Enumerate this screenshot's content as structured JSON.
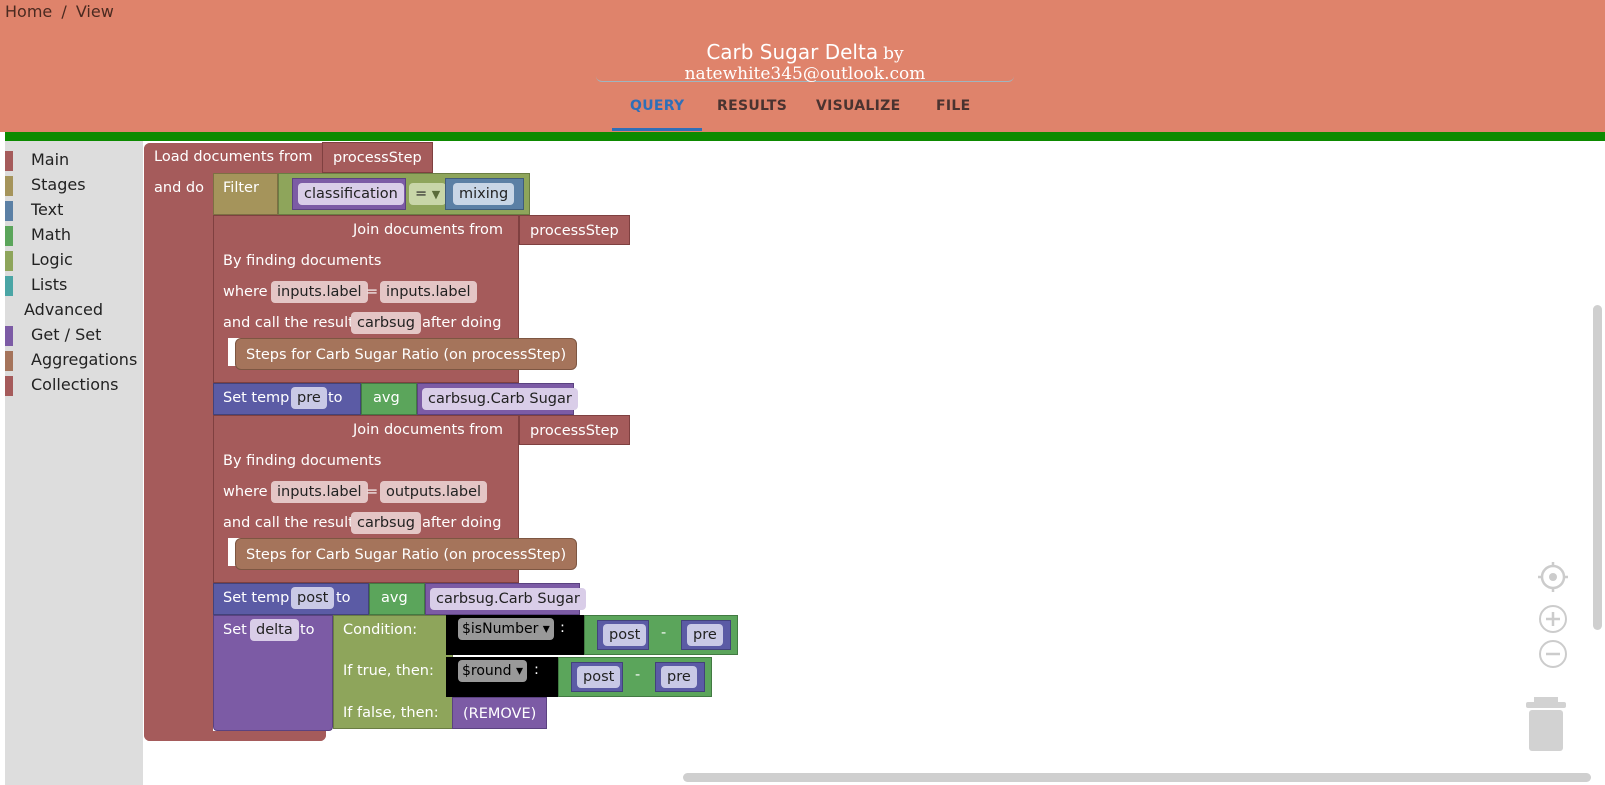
{
  "breadcrumb": [
    "Home",
    "View"
  ],
  "header": {
    "title": "Carb Sugar Delta",
    "author": "by natewhite345@outlook.com",
    "tabs": [
      {
        "label": "QUERY",
        "active": true
      },
      {
        "label": "RESULTS",
        "active": false
      },
      {
        "label": "VISUALIZE",
        "active": false
      },
      {
        "label": "FILE",
        "active": false
      }
    ]
  },
  "colors": {
    "header": "#DF836B",
    "accent_bar": "#0c8a00",
    "active_tab": "#2f6fb8",
    "collections_block": "#A55B5B",
    "stage_block": "#A5745B",
    "logic_block": "#8EA55B",
    "math_block": "#5BA55B",
    "text_block": "#5B80A5",
    "getset_block": "#7C5BA5",
    "variable_block": "#5B5BA5"
  },
  "toolbox": {
    "items": [
      {
        "label": "Main",
        "color": "#A55B5B"
      },
      {
        "label": "Stages",
        "color": "#A5945B"
      },
      {
        "label": "Text",
        "color": "#5B80A5"
      },
      {
        "label": "Math",
        "color": "#5BA55B"
      },
      {
        "label": "Logic",
        "color": "#8EA55B"
      },
      {
        "label": "Lists",
        "color": "#4AA5A5"
      }
    ],
    "advanced_heading": "Advanced",
    "advanced_items": [
      {
        "label": "Get / Set",
        "color": "#7C5BA5"
      },
      {
        "label": "Aggregations",
        "color": "#A5745B"
      },
      {
        "label": "Collections",
        "color": "#A55B5B"
      }
    ]
  },
  "workspace": {
    "load": {
      "label": "Load documents from",
      "collection": "processStep",
      "and_do": "and do"
    },
    "filter": {
      "label": "Filter",
      "field": "classification",
      "op": "=",
      "value": "mixing"
    },
    "join1": {
      "label": "Join documents from",
      "collection": "processStep",
      "by_finding": "By finding documents",
      "where": "where",
      "left": "inputs.label",
      "eq": "=",
      "right": "inputs.label",
      "call_result": "and call the result",
      "var": "carbsug",
      "after_doing": "after doing",
      "steps": "Steps for Carb Sugar Ratio (on processStep)"
    },
    "set_pre": {
      "set_temp": "Set temp",
      "var": "pre",
      "to": "to",
      "fn": "avg",
      "arg": "carbsug.Carb Sugar"
    },
    "join2": {
      "label": "Join documents from",
      "collection": "processStep",
      "by_finding": "By finding documents",
      "where": "where",
      "left": "inputs.label",
      "eq": "=",
      "right": "outputs.label",
      "call_result": "and call the result",
      "var": "carbsug",
      "after_doing": "after doing",
      "steps": "Steps for Carb Sugar Ratio (on processStep)"
    },
    "set_post": {
      "set_temp": "Set temp",
      "var": "post",
      "to": "to",
      "fn": "avg",
      "arg": "carbsug.Carb Sugar"
    },
    "set_delta": {
      "set": "Set",
      "var": "delta",
      "to": "to",
      "condition": "Condition:",
      "if_true": "If true, then:",
      "if_false": "If false, then:",
      "cond_fn": "$isNumber ▾",
      "true_fn": "$round ▾",
      "colon": ":",
      "a": "post",
      "minus": "-",
      "b": "pre",
      "remove": "(REMOVE)"
    }
  }
}
